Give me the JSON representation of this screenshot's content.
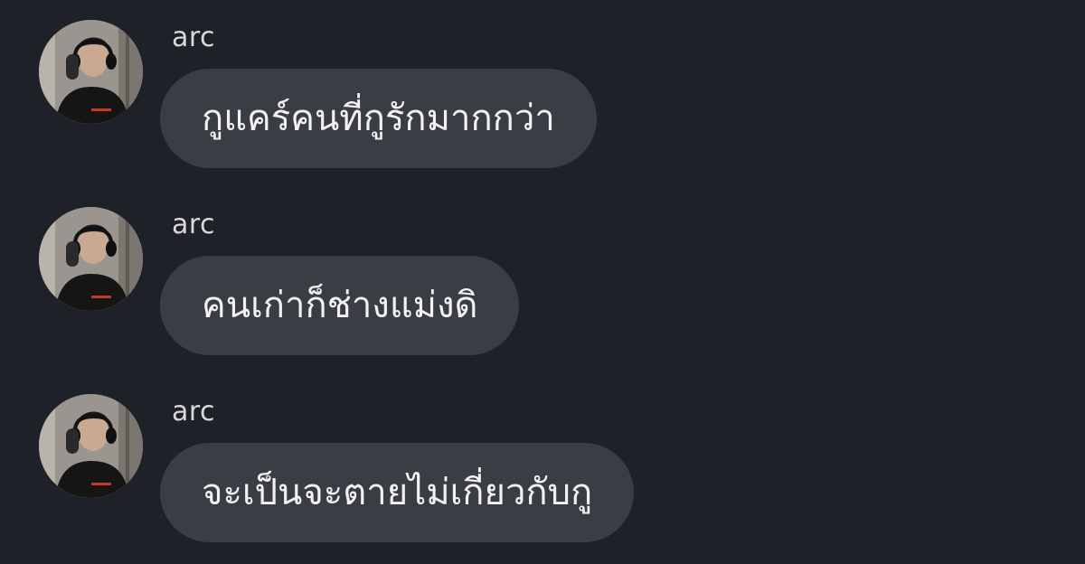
{
  "colors": {
    "background": "#1f2129",
    "bubble": "#3b3d45",
    "bubble_text": "#f2f2f4",
    "sender_text": "#d9d9dc"
  },
  "messages": [
    {
      "sender": "arc",
      "avatar": "user-avatar",
      "text": "กูแคร์คนที่กูรักมากกว่า"
    },
    {
      "sender": "arc",
      "avatar": "user-avatar",
      "text": "คนเก่าก็ช่างแม่งดิ"
    },
    {
      "sender": "arc",
      "avatar": "user-avatar",
      "text": "จะเป็นจะตายไม่เกี่ยวกับกู"
    }
  ]
}
